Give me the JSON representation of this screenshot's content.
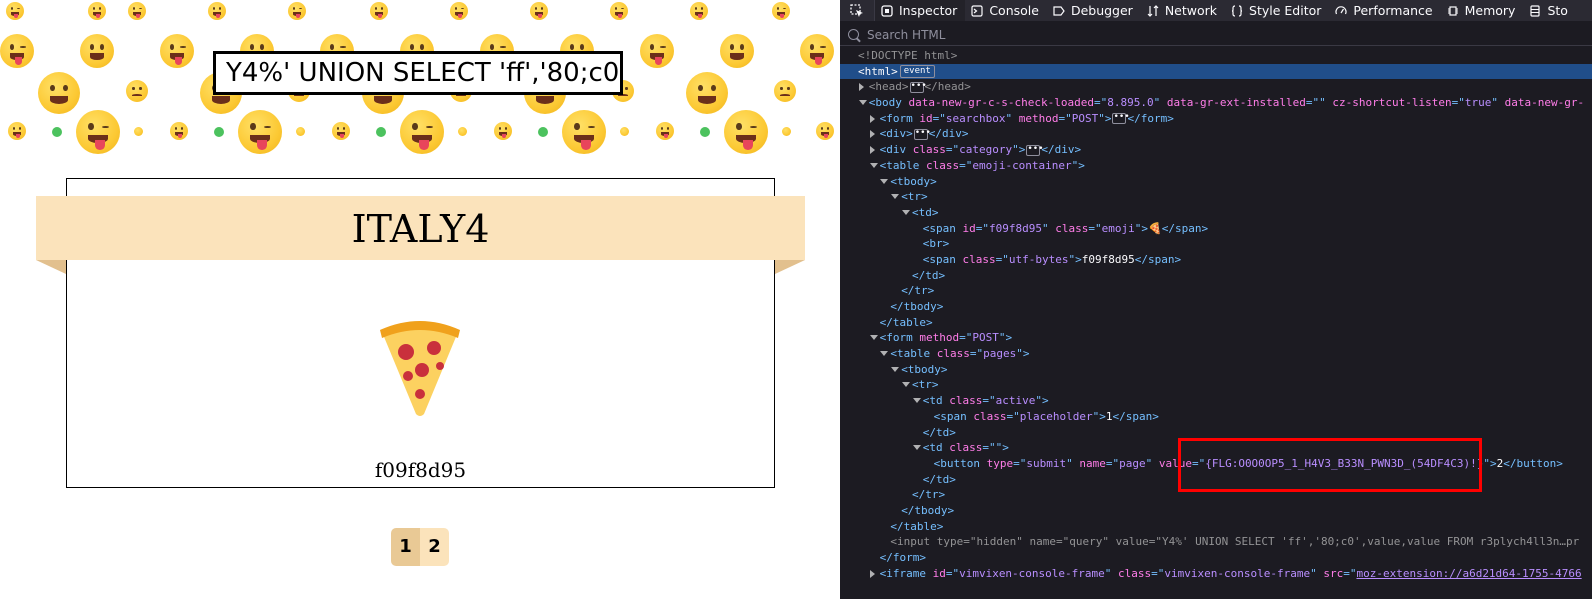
{
  "page": {
    "search_value": "Y4%' UNION SELECT 'ff','80;c0',value,value FROM r3plych4ll3n",
    "category_title": "ITALY4",
    "emoji_char": "🍕",
    "utf_bytes": "f09f8d95",
    "pages": [
      {
        "label": "1",
        "active": true
      },
      {
        "label": "2",
        "active": false
      }
    ],
    "colors": {
      "ribbon": "#fbe3bb",
      "active_page": "#e9c995"
    }
  },
  "devtools": {
    "tabs": [
      {
        "label": "Inspector",
        "icon": "inspector-icon",
        "selected": true
      },
      {
        "label": "Console",
        "icon": "console-icon"
      },
      {
        "label": "Debugger",
        "icon": "debugger-icon"
      },
      {
        "label": "Network",
        "icon": "network-icon"
      },
      {
        "label": "Style Editor",
        "icon": "style-editor-icon"
      },
      {
        "label": "Performance",
        "icon": "performance-icon"
      },
      {
        "label": "Memory",
        "icon": "memory-icon"
      },
      {
        "label": "Sto",
        "icon": "storage-icon"
      }
    ],
    "search_placeholder": "Search HTML",
    "tree": [
      {
        "indent": 0,
        "tw": "none",
        "parts": [
          [
            "c-dim",
            "<!DOCTYPE html>"
          ]
        ]
      },
      {
        "indent": 0,
        "tw": "none",
        "sel": true,
        "parts": [
          [
            "c-text",
            "<html>"
          ],
          [
            "badge",
            "event"
          ]
        ]
      },
      {
        "indent": 1,
        "tw": "closed",
        "parts": [
          [
            "c-dim",
            "<head>"
          ],
          [
            "ellip",
            "•••"
          ],
          [
            "c-dim",
            "</head>"
          ]
        ]
      },
      {
        "indent": 1,
        "tw": "open",
        "parts": [
          [
            "c-tag",
            "<body "
          ],
          [
            "c-attr",
            "data-new-gr-c-s-check-loaded"
          ],
          [
            "c-tag",
            "=\""
          ],
          [
            "c-val",
            "8.895.0"
          ],
          [
            "c-tag",
            "\" "
          ],
          [
            "c-attr",
            "data-gr-ext-installed"
          ],
          [
            "c-tag",
            "=\"\" "
          ],
          [
            "c-attr",
            "cz-shortcut-listen"
          ],
          [
            "c-tag",
            "=\""
          ],
          [
            "c-val",
            "true"
          ],
          [
            "c-tag",
            "\" "
          ],
          [
            "c-attr",
            "data-new-gr-"
          ]
        ]
      },
      {
        "indent": 2,
        "tw": "closed",
        "parts": [
          [
            "c-tag",
            "<form "
          ],
          [
            "c-attr",
            "id"
          ],
          [
            "c-tag",
            "=\""
          ],
          [
            "c-val",
            "searchbox"
          ],
          [
            "c-tag",
            "\" "
          ],
          [
            "c-attr",
            "method"
          ],
          [
            "c-tag",
            "=\""
          ],
          [
            "c-val",
            "POST"
          ],
          [
            "c-tag",
            "\">"
          ],
          [
            "ellip",
            "•••"
          ],
          [
            "c-tag",
            "</form>"
          ]
        ]
      },
      {
        "indent": 2,
        "tw": "closed",
        "parts": [
          [
            "c-tag",
            "<div>"
          ],
          [
            "ellip",
            "•••"
          ],
          [
            "c-tag",
            "</div>"
          ]
        ]
      },
      {
        "indent": 2,
        "tw": "closed",
        "parts": [
          [
            "c-tag",
            "<div "
          ],
          [
            "c-attr",
            "class"
          ],
          [
            "c-tag",
            "=\""
          ],
          [
            "c-val",
            "category"
          ],
          [
            "c-tag",
            "\">"
          ],
          [
            "ellip",
            "•••"
          ],
          [
            "c-tag",
            "</div>"
          ]
        ]
      },
      {
        "indent": 2,
        "tw": "open",
        "parts": [
          [
            "c-tag",
            "<table "
          ],
          [
            "c-attr",
            "class"
          ],
          [
            "c-tag",
            "=\""
          ],
          [
            "c-val",
            "emoji-container"
          ],
          [
            "c-tag",
            "\">"
          ]
        ]
      },
      {
        "indent": 3,
        "tw": "open",
        "parts": [
          [
            "c-tag",
            "<tbody>"
          ]
        ]
      },
      {
        "indent": 4,
        "tw": "open",
        "parts": [
          [
            "c-tag",
            "<tr>"
          ]
        ]
      },
      {
        "indent": 5,
        "tw": "open",
        "parts": [
          [
            "c-tag",
            "<td>"
          ]
        ]
      },
      {
        "indent": 6,
        "tw": "none",
        "parts": [
          [
            "c-tag",
            "<span "
          ],
          [
            "c-attr",
            "id"
          ],
          [
            "c-tag",
            "=\""
          ],
          [
            "c-val",
            "f09f8d95"
          ],
          [
            "c-tag",
            "\" "
          ],
          [
            "c-attr",
            "class"
          ],
          [
            "c-tag",
            "=\""
          ],
          [
            "c-val",
            "emoji"
          ],
          [
            "c-tag",
            "\">"
          ],
          [
            "c-text",
            "🍕"
          ],
          [
            "c-tag",
            "</span>"
          ]
        ]
      },
      {
        "indent": 6,
        "tw": "none",
        "parts": [
          [
            "c-tag",
            "<br>"
          ]
        ]
      },
      {
        "indent": 6,
        "tw": "none",
        "parts": [
          [
            "c-tag",
            "<span "
          ],
          [
            "c-attr",
            "class"
          ],
          [
            "c-tag",
            "=\""
          ],
          [
            "c-val",
            "utf-bytes"
          ],
          [
            "c-tag",
            "\">"
          ],
          [
            "c-text",
            "f09f8d95"
          ],
          [
            "c-tag",
            "</span>"
          ]
        ]
      },
      {
        "indent": 5,
        "tw": "none",
        "parts": [
          [
            "c-tag",
            "</td>"
          ]
        ]
      },
      {
        "indent": 4,
        "tw": "none",
        "parts": [
          [
            "c-tag",
            "</tr>"
          ]
        ]
      },
      {
        "indent": 3,
        "tw": "none",
        "parts": [
          [
            "c-tag",
            "</tbody>"
          ]
        ]
      },
      {
        "indent": 2,
        "tw": "none",
        "parts": [
          [
            "c-tag",
            "</table>"
          ]
        ]
      },
      {
        "indent": 2,
        "tw": "open",
        "parts": [
          [
            "c-tag",
            "<form "
          ],
          [
            "c-attr",
            "method"
          ],
          [
            "c-tag",
            "=\""
          ],
          [
            "c-val",
            "POST"
          ],
          [
            "c-tag",
            "\">"
          ]
        ]
      },
      {
        "indent": 3,
        "tw": "open",
        "parts": [
          [
            "c-tag",
            "<table "
          ],
          [
            "c-attr",
            "class"
          ],
          [
            "c-tag",
            "=\""
          ],
          [
            "c-val",
            "pages"
          ],
          [
            "c-tag",
            "\">"
          ]
        ]
      },
      {
        "indent": 4,
        "tw": "open",
        "parts": [
          [
            "c-tag",
            "<tbody>"
          ]
        ]
      },
      {
        "indent": 5,
        "tw": "open",
        "parts": [
          [
            "c-tag",
            "<tr>"
          ]
        ]
      },
      {
        "indent": 6,
        "tw": "open",
        "parts": [
          [
            "c-tag",
            "<td "
          ],
          [
            "c-attr",
            "class"
          ],
          [
            "c-tag",
            "=\""
          ],
          [
            "c-val",
            "active"
          ],
          [
            "c-tag",
            "\">"
          ]
        ]
      },
      {
        "indent": 7,
        "tw": "none",
        "parts": [
          [
            "c-tag",
            "<span "
          ],
          [
            "c-attr",
            "class"
          ],
          [
            "c-tag",
            "=\""
          ],
          [
            "c-val",
            "placeholder"
          ],
          [
            "c-tag",
            "\">"
          ],
          [
            "c-text",
            "1"
          ],
          [
            "c-tag",
            "</span>"
          ]
        ]
      },
      {
        "indent": 6,
        "tw": "none",
        "parts": [
          [
            "c-tag",
            "</td>"
          ]
        ]
      },
      {
        "indent": 6,
        "tw": "open",
        "parts": [
          [
            "c-tag",
            "<td "
          ],
          [
            "c-attr",
            "class"
          ],
          [
            "c-tag",
            "=\"\">"
          ]
        ]
      },
      {
        "indent": 7,
        "tw": "none",
        "parts": [
          [
            "c-tag",
            "<button "
          ],
          [
            "c-attr",
            "type"
          ],
          [
            "c-tag",
            "=\""
          ],
          [
            "c-val",
            "submit"
          ],
          [
            "c-tag",
            "\" "
          ],
          [
            "c-attr",
            "name"
          ],
          [
            "c-tag",
            "=\""
          ],
          [
            "c-val",
            "page"
          ],
          [
            "c-tag",
            "\" "
          ],
          [
            "c-attr",
            "value"
          ],
          [
            "c-tag",
            "=\""
          ],
          [
            "c-val",
            "{FLG:O0O0OP5_1_H4V3_B33N_PWN3D_(54DF4C3)!}"
          ],
          [
            "c-tag",
            "\">"
          ],
          [
            "c-text",
            "2"
          ],
          [
            "c-tag",
            "</button>"
          ]
        ]
      },
      {
        "indent": 6,
        "tw": "none",
        "parts": [
          [
            "c-tag",
            "</td>"
          ]
        ]
      },
      {
        "indent": 5,
        "tw": "none",
        "parts": [
          [
            "c-tag",
            "</tr>"
          ]
        ]
      },
      {
        "indent": 4,
        "tw": "none",
        "parts": [
          [
            "c-tag",
            "</tbody>"
          ]
        ]
      },
      {
        "indent": 3,
        "tw": "none",
        "parts": [
          [
            "c-tag",
            "</table>"
          ]
        ]
      },
      {
        "indent": 3,
        "tw": "none",
        "parts": [
          [
            "c-dim",
            "<input "
          ],
          [
            "c-dim",
            "type"
          ],
          [
            "c-dim",
            "=\""
          ],
          [
            "c-dim",
            "hidden"
          ],
          [
            "c-dim",
            "\" "
          ],
          [
            "c-dim",
            "name"
          ],
          [
            "c-dim",
            "=\""
          ],
          [
            "c-dim",
            "query"
          ],
          [
            "c-dim",
            "\" "
          ],
          [
            "c-dim",
            "value"
          ],
          [
            "c-dim",
            "=\""
          ],
          [
            "c-dim",
            "Y4%' UNION SELECT 'ff','80;c0',value,value FROM r3plych4ll3n…pr"
          ]
        ]
      },
      {
        "indent": 2,
        "tw": "none",
        "parts": [
          [
            "c-tag",
            "</form>"
          ]
        ]
      },
      {
        "indent": 2,
        "tw": "closed",
        "parts": [
          [
            "c-tag",
            "<iframe "
          ],
          [
            "c-attr",
            "id"
          ],
          [
            "c-tag",
            "=\""
          ],
          [
            "c-val",
            "vimvixen-console-frame"
          ],
          [
            "c-tag",
            "\" "
          ],
          [
            "c-attr",
            "class"
          ],
          [
            "c-tag",
            "=\""
          ],
          [
            "c-val",
            "vimvixen-console-frame"
          ],
          [
            "c-tag",
            "\" "
          ],
          [
            "c-attr",
            "src"
          ],
          [
            "c-tag",
            "=\""
          ],
          [
            "c-link",
            "moz-extension://a6d21d64-1755-4766"
          ]
        ]
      }
    ]
  }
}
